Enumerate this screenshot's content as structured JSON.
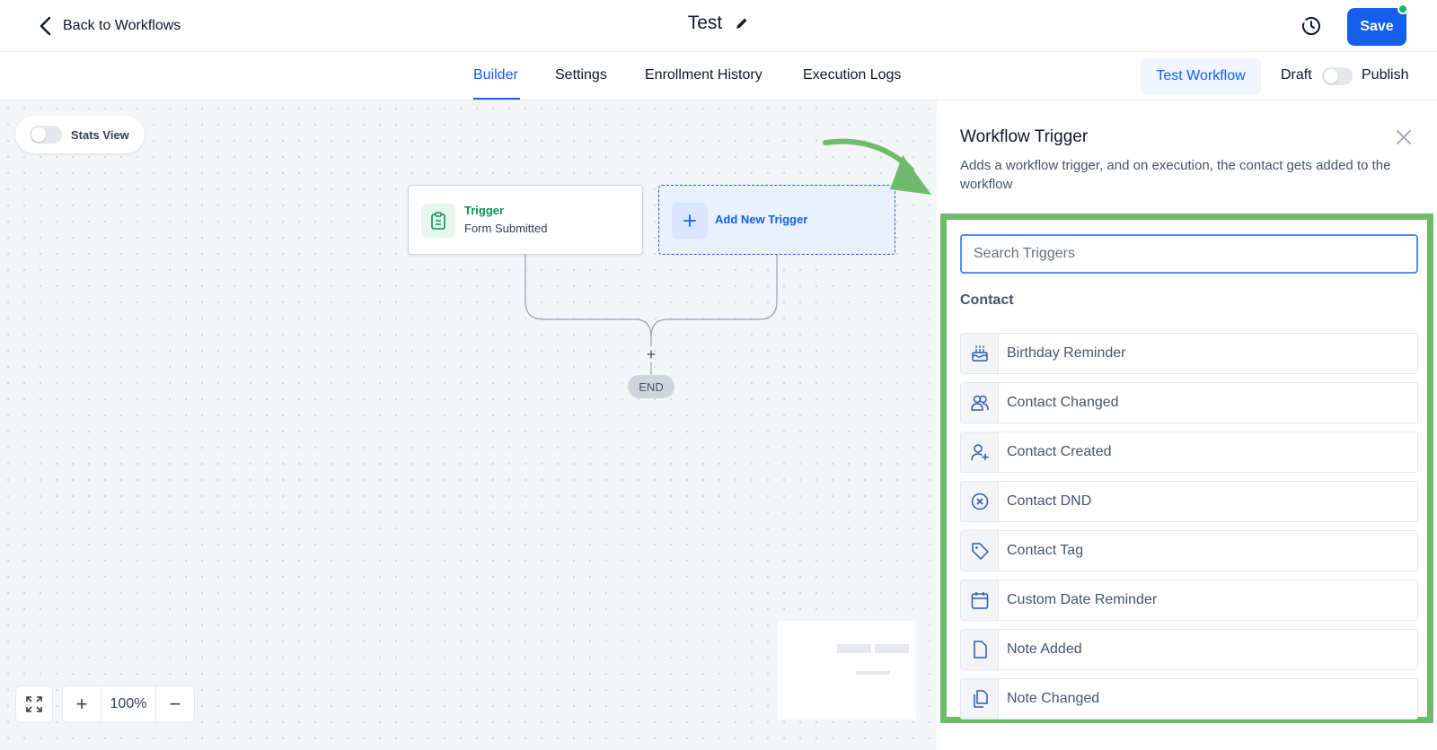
{
  "header": {
    "back_label": "Back to Workflows",
    "title": "Test",
    "save_label": "Save"
  },
  "tabs": [
    {
      "label": "Builder",
      "active": true
    },
    {
      "label": "Settings",
      "active": false
    },
    {
      "label": "Enrollment History",
      "active": false
    },
    {
      "label": "Execution Logs",
      "active": false
    }
  ],
  "actions": {
    "test_workflow_label": "Test Workflow",
    "draft_label": "Draft",
    "publish_label": "Publish",
    "published": false
  },
  "canvas": {
    "stats_view_label": "Stats View",
    "stats_view_on": false,
    "trigger_node": {
      "title": "Trigger",
      "subtitle": "Form Submitted"
    },
    "add_trigger_label": "Add New Trigger",
    "end_label": "END",
    "zoom_level": "100%"
  },
  "panel": {
    "title": "Workflow Trigger",
    "description": "Adds a workflow trigger, and on execution, the contact gets added to the workflow",
    "search_placeholder": "Search Triggers",
    "section": "Contact",
    "triggers": [
      {
        "label": "Birthday Reminder",
        "icon": "cake-icon"
      },
      {
        "label": "Contact Changed",
        "icon": "users-icon"
      },
      {
        "label": "Contact Created",
        "icon": "user-plus-icon"
      },
      {
        "label": "Contact DND",
        "icon": "x-circle-icon"
      },
      {
        "label": "Contact Tag",
        "icon": "tag-icon"
      },
      {
        "label": "Custom Date Reminder",
        "icon": "calendar-icon"
      },
      {
        "label": "Note Added",
        "icon": "file-icon"
      },
      {
        "label": "Note Changed",
        "icon": "copy-icon"
      }
    ]
  },
  "colors": {
    "primary": "#155eef",
    "success": "#079455",
    "highlight": "#6dbb6b"
  }
}
